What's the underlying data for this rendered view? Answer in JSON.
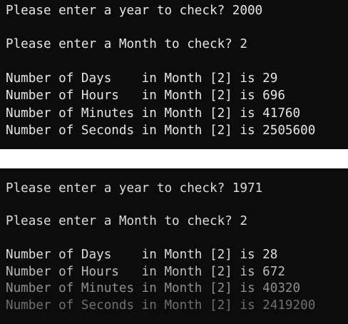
{
  "colors": {
    "console_background": "#0c0c0c",
    "console_text": "#e6e6e6",
    "separator_background": "#ffffff"
  },
  "console_top": {
    "lines": [
      "Please enter a year to check? 2000",
      "Please enter a Month to check? 2",
      "Number of Days    in Month [2] is 29",
      "Number of Hours   in Month [2] is 696",
      "Number of Minutes in Month [2] is 41760",
      "Number of Seconds in Month [2] is 2505600"
    ]
  },
  "console_bottom": {
    "lines": [
      "Please enter a year to check? 1971",
      "Please enter a Month to check? 2",
      "Number of Days    in Month [2] is 28",
      "Number of Hours   in Month [2] is 672",
      "Number of Minutes in Month [2] is 40320",
      "Number of Seconds in Month [2] is 2419200"
    ]
  }
}
